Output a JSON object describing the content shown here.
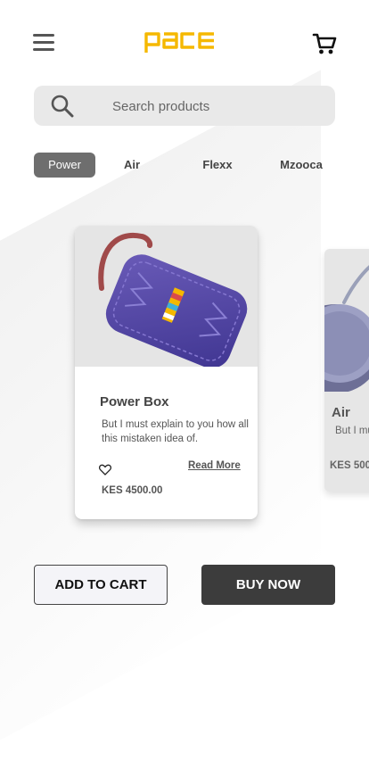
{
  "app": {
    "logo_text": "pace"
  },
  "colors": {
    "brand": "#f5b800",
    "active_tab": "#6e6e6e",
    "buy_button": "#3c3c3c"
  },
  "header": {
    "menu_icon": "hamburger-menu-icon",
    "cart_icon": "shopping-cart-icon"
  },
  "search": {
    "placeholder": "Search products",
    "value": "",
    "icon": "search-icon"
  },
  "tabs": [
    {
      "label": "Power",
      "active": true
    },
    {
      "label": "Air",
      "active": false
    },
    {
      "label": "Flexx",
      "active": false
    },
    {
      "label": "Mzooca",
      "active": false
    }
  ],
  "products": [
    {
      "name": "Power Box",
      "description": "But I must explain to you how all this mistaken idea of.",
      "read_more": "Read More",
      "price": "KES 4500.00",
      "favorite_icon": "heart-outline-icon"
    },
    {
      "name": "Air",
      "description": "But I must explain to you how",
      "price": "KES 500"
    }
  ],
  "actions": {
    "add_to_cart": "ADD TO CART",
    "buy_now": "BUY NOW"
  }
}
